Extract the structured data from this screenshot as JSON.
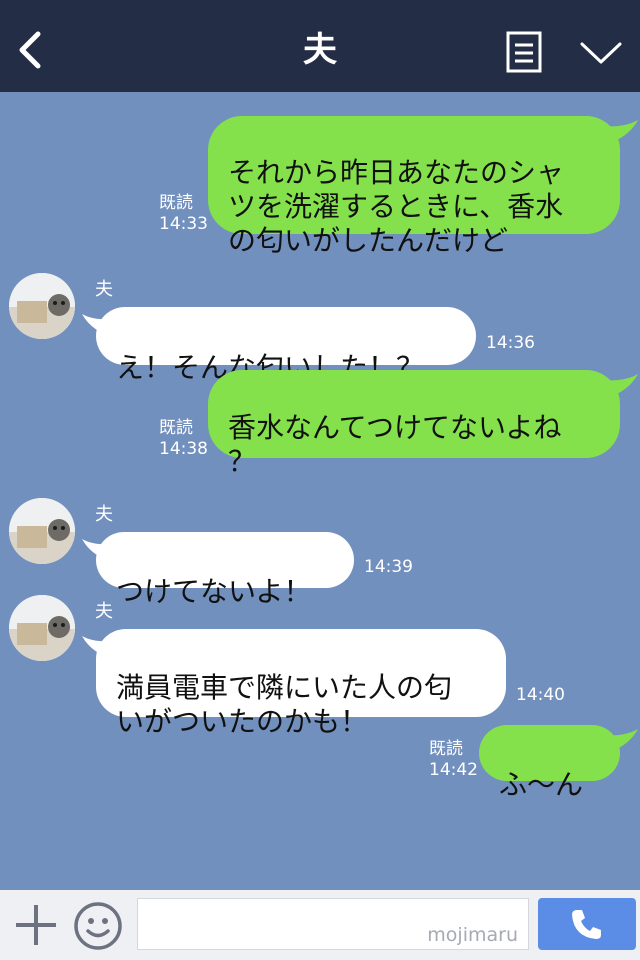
{
  "header": {
    "title": "夫"
  },
  "messages": [
    {
      "side": "right",
      "text": "それから昨日あなたのシャ\nツを洗濯するときに、香水\nの匂いがしたんだけど",
      "read": "既読",
      "time": "14:33"
    },
    {
      "side": "left",
      "sender": "夫",
      "text": "え！そんな匂いした！？",
      "time": "14:36"
    },
    {
      "side": "right",
      "text": "香水なんてつけてないよね\n？",
      "read": "既読",
      "time": "14:38"
    },
    {
      "side": "left",
      "sender": "夫",
      "text": "つけてないよ！",
      "time": "14:39"
    },
    {
      "side": "left",
      "sender": "夫",
      "text": "満員電車で隣にいた人の匂\nいがついたのかも！",
      "time": "14:40"
    },
    {
      "side": "right",
      "text": "ふ〜ん",
      "read": "既読",
      "time": "14:42"
    }
  ],
  "input": {
    "watermark": "mojimaru"
  },
  "colors": {
    "header_bg": "#232e46",
    "chat_bg": "#7290be",
    "outgoing_bubble": "#84e14c",
    "incoming_bubble": "#ffffff",
    "send_button": "#5b8de6"
  },
  "icons": [
    "back-icon",
    "note-icon",
    "chevron-down-icon",
    "plus-icon",
    "emoji-icon",
    "phone-icon"
  ]
}
